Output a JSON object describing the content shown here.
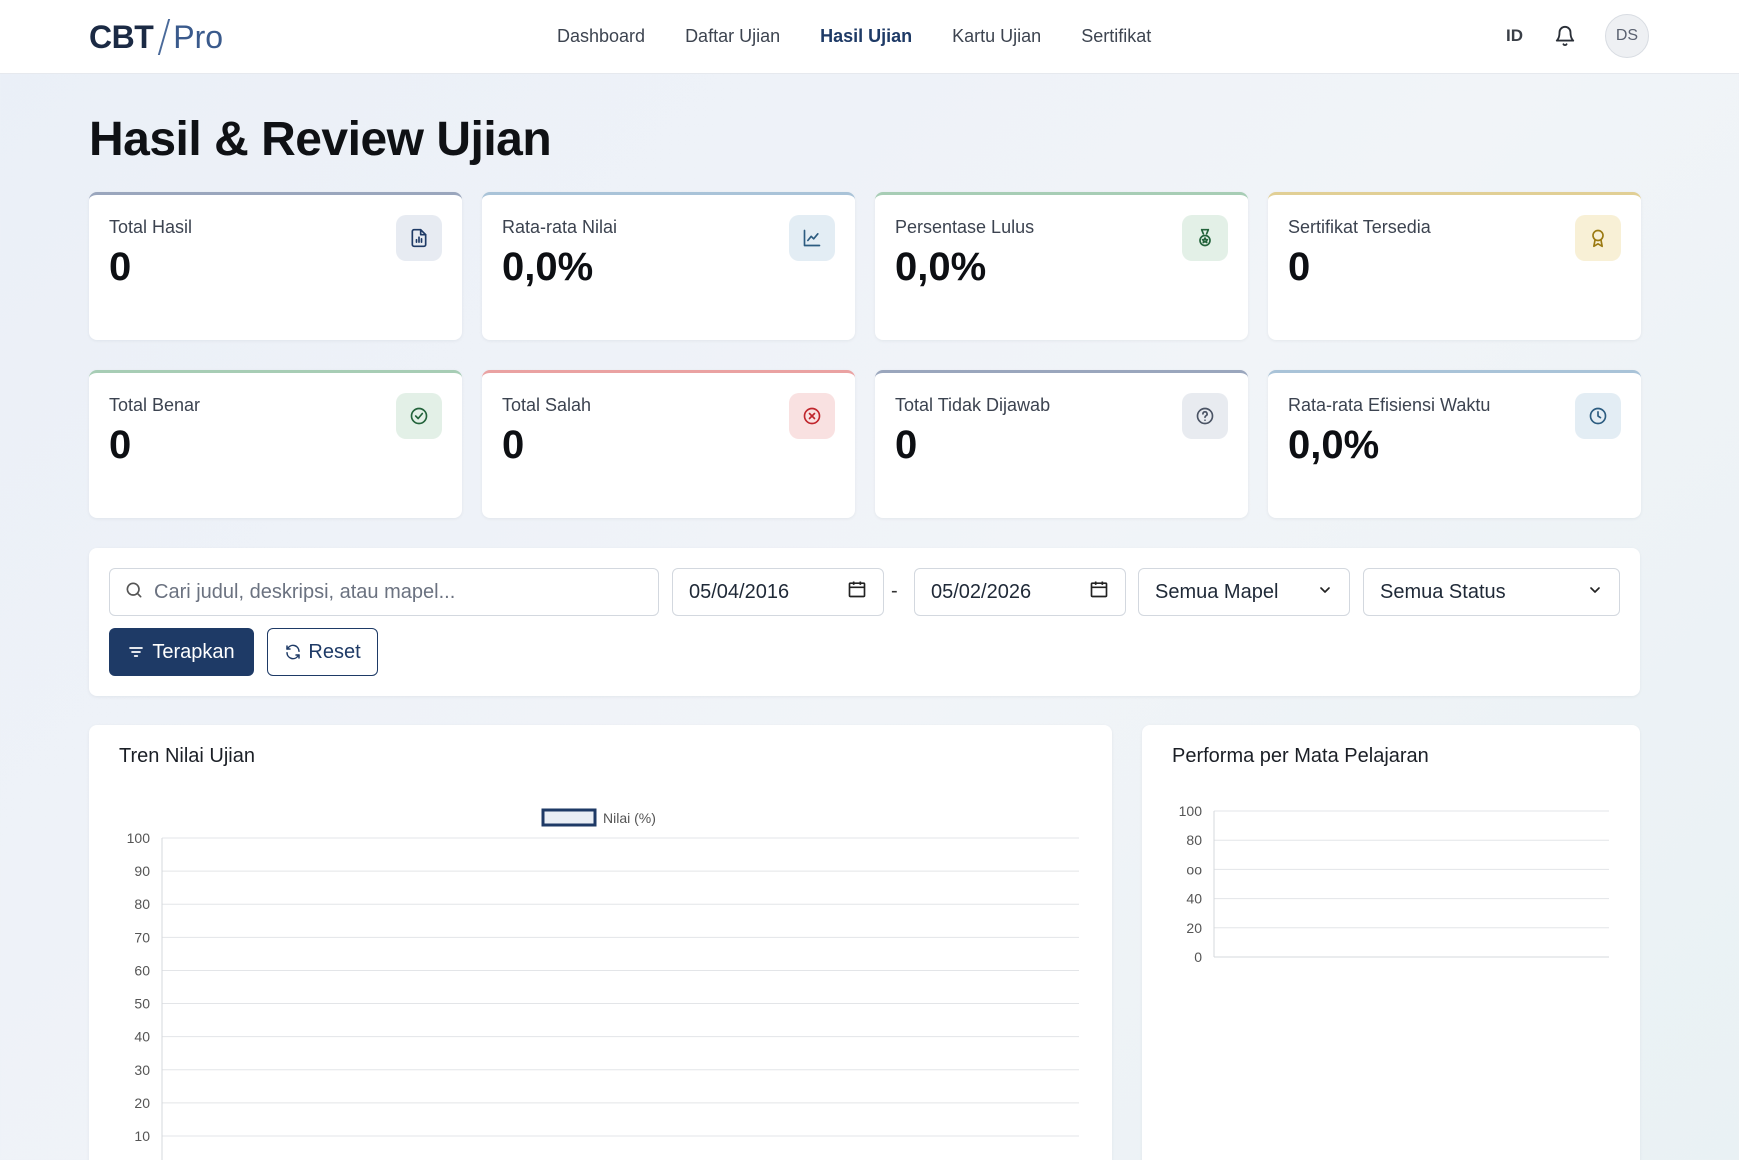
{
  "brand": {
    "name": "CBT",
    "suffix": "Pro"
  },
  "nav": {
    "items": [
      {
        "label": "Dashboard",
        "active": false
      },
      {
        "label": "Daftar Ujian",
        "active": false
      },
      {
        "label": "Hasil Ujian",
        "active": true
      },
      {
        "label": "Kartu Ujian",
        "active": false
      },
      {
        "label": "Sertifikat",
        "active": false
      }
    ],
    "language": "ID",
    "avatar_initials": "DS"
  },
  "page": {
    "title": "Hasil & Review Ujian"
  },
  "stats": [
    {
      "label": "Total Hasil",
      "value": "0",
      "icon": "report-icon",
      "accent": "#9aa6bd",
      "icon_bg": "#e7ebf2",
      "icon_color": "#1e3a66"
    },
    {
      "label": "Rata-rata Nilai",
      "value": "0,0%",
      "icon": "chart-line-icon",
      "accent": "#a9c3d8",
      "icon_bg": "#e3edf4",
      "icon_color": "#2c5c80"
    },
    {
      "label": "Persentase Lulus",
      "value": "0,0%",
      "icon": "medal-icon",
      "accent": "#a7cdb5",
      "icon_bg": "#e3f0e7",
      "icon_color": "#23633b"
    },
    {
      "label": "Sertifikat Tersedia",
      "value": "0",
      "icon": "award-icon",
      "accent": "#e1cf95",
      "icon_bg": "#f8f0d6",
      "icon_color": "#9b7a12"
    },
    {
      "label": "Total Benar",
      "value": "0",
      "icon": "check-circle-icon",
      "accent": "#a7cdb5",
      "icon_bg": "#e3f0e7",
      "icon_color": "#23633b"
    },
    {
      "label": "Total Salah",
      "value": "0",
      "icon": "x-circle-icon",
      "accent": "#eaa2a2",
      "icon_bg": "#f9e1e1",
      "icon_color": "#c0262d"
    },
    {
      "label": "Total Tidak Dijawab",
      "value": "0",
      "icon": "question-circle-icon",
      "accent": "#9aa6bd",
      "icon_bg": "#e8ebf0",
      "icon_color": "#4a5364"
    },
    {
      "label": "Rata-rata Efisiensi Waktu",
      "value": "0,0%",
      "icon": "clock-icon",
      "accent": "#a9c3d8",
      "icon_bg": "#e3edf4",
      "icon_color": "#2c5c80"
    }
  ],
  "filters": {
    "search_placeholder": "Cari judul, deskripsi, atau mapel...",
    "date_from": "05/04/2016",
    "date_separator": "-",
    "date_to": "05/02/2026",
    "subject_select": "Semua Mapel",
    "status_select": "Semua Status",
    "apply_label": "Terapkan",
    "reset_label": "Reset"
  },
  "charts": {
    "trend": {
      "title": "Tren Nilai Ujian"
    },
    "subject": {
      "title": "Performa per Mata Pelajaran"
    }
  },
  "chart_data": [
    {
      "type": "line",
      "title": "Tren Nilai Ujian",
      "series": [
        {
          "name": "Nilai (%)",
          "values": []
        }
      ],
      "x": [],
      "ylim": [
        0,
        100
      ],
      "yticks": [
        "100",
        "90",
        "80",
        "70",
        "60",
        "50",
        "40",
        "30",
        "20",
        "10"
      ],
      "grid": true,
      "legend": "top-center"
    },
    {
      "type": "bar",
      "title": "Performa per Mata Pelajaran",
      "categories": [],
      "values": [],
      "ylim": [
        0,
        100
      ],
      "yticks": [
        "100",
        "80",
        "oo",
        "40",
        "20",
        "0"
      ],
      "grid": true
    }
  ]
}
